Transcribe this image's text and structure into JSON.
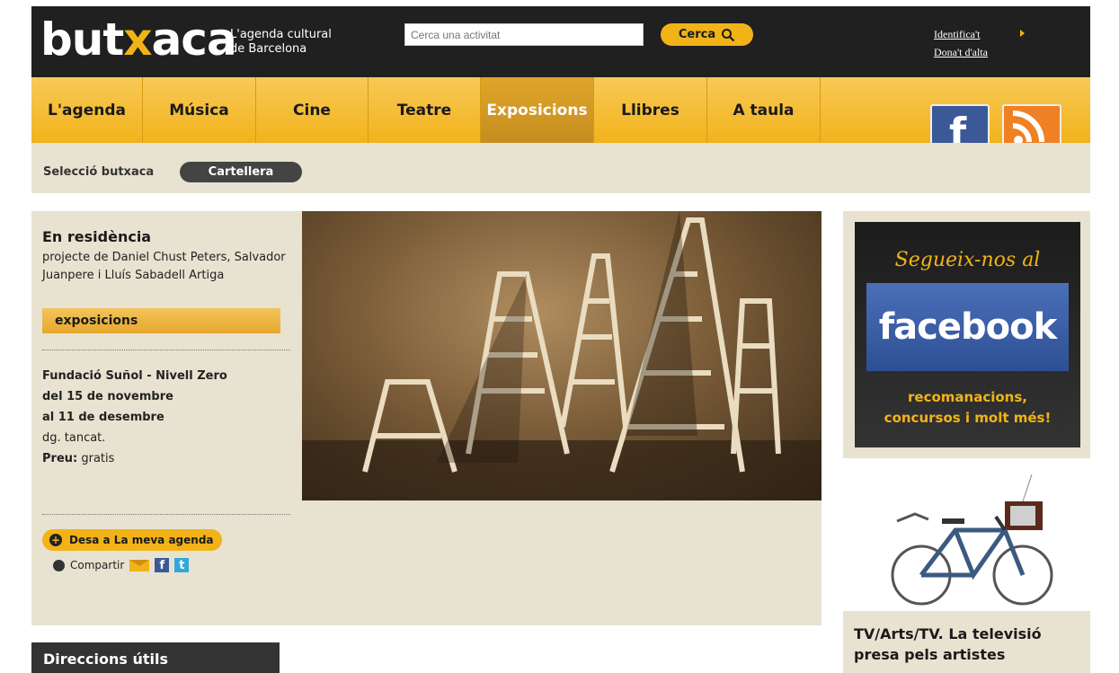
{
  "header": {
    "logo_pre": "but",
    "logo_x": "x",
    "logo_post": "aca",
    "tagline_line1": "L'agenda cultural",
    "tagline_line2": "de Barcelona",
    "search_placeholder": "Cerca una activitat",
    "search_button": "Cerca",
    "login_link": "Identifica't",
    "register_link": "Dona't d'alta"
  },
  "nav": {
    "items": [
      "L'agenda",
      "Música",
      "Cine",
      "Teatre",
      "Exposicions",
      "Llibres",
      "A taula"
    ],
    "active": "Exposicions"
  },
  "subnav": {
    "item1": "Selecció butxaca",
    "item2": "Cartellera"
  },
  "event": {
    "title": "En residència",
    "description": "projecte de Daniel Chust Peters, Salvador Juanpere i Lluís Sabadell Artiga",
    "category": "exposicions",
    "venue": "Fundació Suñol - Nivell Zero",
    "date_from": "del 15 de novembre",
    "date_to": "al 11 de desembre",
    "closed": "dg. tancat.",
    "price_label": "Preu:",
    "price_value": " gratis",
    "save_button": "Desa a La meva agenda",
    "share_label": "Compartir"
  },
  "sidebar": {
    "fb_script": "Segueix-nos al",
    "fb_logo": "facebook",
    "fb_caption_line1": "recomanacions,",
    "fb_caption_line2": "concursos i molt més!",
    "article_title_line1": "TV/Arts/TV. La televisió",
    "article_title_line2": "presa pels artistes"
  },
  "useful": {
    "title": "Direccions útils"
  },
  "colors": {
    "accent": "#f2b318",
    "dark": "#202020",
    "panel": "#e8e2d0",
    "facebook": "#3b5998"
  }
}
